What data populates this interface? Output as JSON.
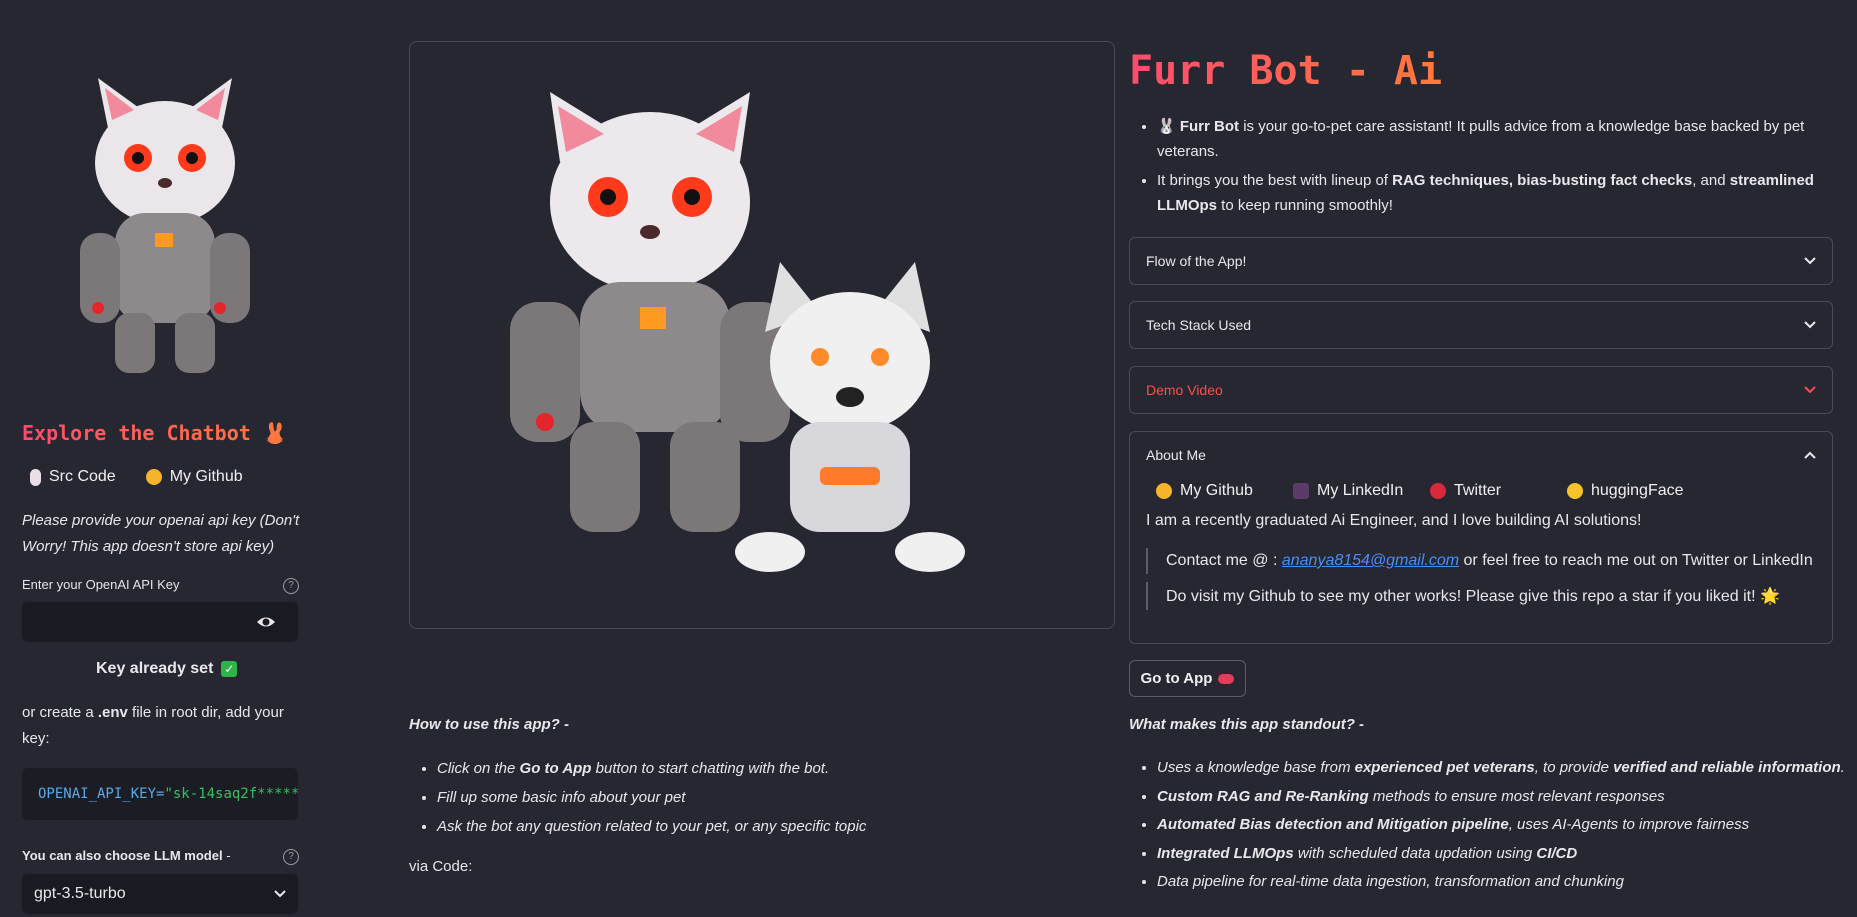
{
  "sidebar": {
    "title": "Explore the Chatbot 🐰",
    "links": [
      {
        "label": "Src Code",
        "icon": "mouse-icon"
      },
      {
        "label": "My Github",
        "icon": "cat-icon"
      }
    ],
    "api_note": "Please provide your openai api key (Don't Worry! This app doesn't store api key)",
    "api_label": "Enter your OpenAI API Key",
    "api_value": "",
    "key_status": "Key already set",
    "env_note_prefix": "or create a ",
    "env_note_file": ".env",
    "env_note_suffix": " file in root dir, add your key:",
    "code_key": "OPENAI_API_KEY",
    "code_eq": "=",
    "code_val": "\"sk-14saq2f*****",
    "llm_label": "You can also choose LLM model",
    "llm_label_suffix": " -",
    "llm_selected": "gpt-3.5-turbo"
  },
  "main": {
    "title": "Furr Bot - Ai",
    "intro": {
      "b1_icon": "🐰",
      "b1_bold": "Furr Bot",
      "b1_text": " is your go-to-pet care assistant! It pulls advice from a knowledge base backed by pet veterans.",
      "b2_pre": "It brings you the best with lineup of ",
      "b2_bold1": "RAG techniques, bias-busting fact checks",
      "b2_mid": ", and ",
      "b2_bold2": "streamlined LLMOps",
      "b2_post": " to keep running smoothly!"
    },
    "expanders": [
      {
        "label": "Flow of the App!"
      },
      {
        "label": "Tech Stack Used"
      },
      {
        "label": "Demo Video"
      },
      {
        "label": "About Me"
      }
    ],
    "about": {
      "links": [
        {
          "label": "My Github",
          "icon": "cat-icon"
        },
        {
          "label": "My LinkedIn",
          "icon": "handshake-icon"
        },
        {
          "label": "Twitter",
          "icon": "bird-icon"
        },
        {
          "label": "huggingFace",
          "icon": "hugging-face-icon"
        }
      ],
      "bio": "I am a recently graduated Ai Engineer, and I love building AI solutions!",
      "contact_pre": "Contact me @ : ",
      "contact_email": "ananya8154@gmail.com",
      "contact_post": " or feel free to reach me out on Twitter or LinkedIn",
      "visit": "Do visit my Github to see my other works! Please give this repo a star if you liked it! 🌟"
    },
    "go_button": "Go to App",
    "howto": {
      "title": "How to use this app? -",
      "items": [
        {
          "pre": "Click on the ",
          "bold": "Go to App",
          "post": " button to start chatting with the bot."
        },
        {
          "pre": "Fill up some basic info about your pet",
          "bold": "",
          "post": ""
        },
        {
          "pre": "Ask the bot any question related to your pet, or any specific topic",
          "bold": "",
          "post": ""
        }
      ],
      "via": "via Code:"
    },
    "standout": {
      "title": "What makes this app standout? -",
      "items": [
        {
          "p1": "Uses a knowledge base from ",
          "b1": "experienced pet veterans",
          "p2": ", to provide ",
          "b2": "verified and reliable information",
          "p3": "."
        },
        {
          "p1": "",
          "b1": "Custom RAG and Re-Ranking",
          "p2": " methods to ensure most relevant responses",
          "b2": "",
          "p3": ""
        },
        {
          "p1": "",
          "b1": "Automated Bias detection and Mitigation pipeline",
          "p2": ", uses AI-Agents to improve fairness",
          "b2": "",
          "p3": ""
        },
        {
          "p1": "",
          "b1": "Integrated LLMOps",
          "p2": " with scheduled data updation using ",
          "b2": "CI/CD",
          "p3": ""
        },
        {
          "p1": "Data pipeline for real-time data ingestion, transformation and chunking",
          "b1": "",
          "p2": "",
          "b2": "",
          "p3": ""
        }
      ]
    }
  },
  "colors": {
    "accent": "#ff4b6e",
    "bg": "#262730",
    "link": "#4b8df5"
  }
}
